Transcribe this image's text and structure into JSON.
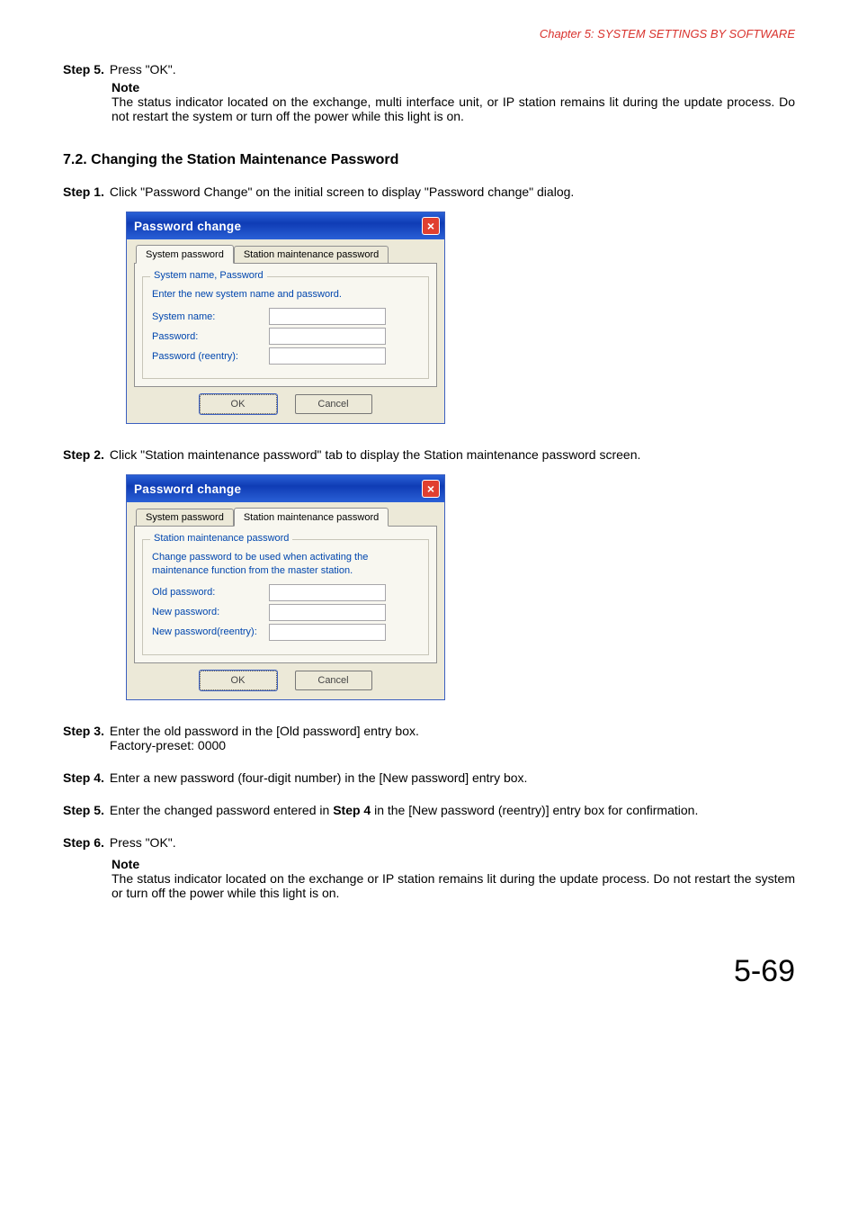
{
  "chapter_header": "Chapter 5:  SYSTEM SETTINGS BY SOFTWARE",
  "top_step": {
    "label": "Step 5.",
    "text": "Press \"OK\".",
    "note_title": "Note",
    "note_text": "The status indicator located on the exchange, multi interface unit, or IP station remains lit during the update process. Do not restart the system or turn off the power while this light is on."
  },
  "section_heading": "7.2. Changing the Station Maintenance Password",
  "step1": {
    "label": "Step 1.",
    "text": "Click \"Password Change\" on the initial screen to display \"Password change\" dialog."
  },
  "dialog1": {
    "title": "Password change",
    "tab1": "System password",
    "tab2": "Station maintenance password",
    "group_title": "System name, Password",
    "group_desc": "Enter the new system name and password.",
    "row1": "System name:",
    "row2": "Password:",
    "row3": "Password (reentry):",
    "ok": "OK",
    "cancel": "Cancel"
  },
  "step2": {
    "label": "Step 2.",
    "text": "Click \"Station maintenance password\" tab to display the Station maintenance password screen."
  },
  "dialog2": {
    "title": "Password change",
    "tab1": "System password",
    "tab2": "Station maintenance password",
    "group_title": "Station maintenance password",
    "group_desc": "Change password to be used when activating the maintenance function from the master station.",
    "row1": "Old password:",
    "row2": "New password:",
    "row3": "New password(reentry):",
    "ok": "OK",
    "cancel": "Cancel"
  },
  "step3": {
    "label": "Step 3.",
    "text_line1": "Enter the old password in the [Old password] entry box.",
    "text_line2": "Factory-preset: 0000"
  },
  "step4": {
    "label": "Step 4.",
    "text": "Enter a new password (four-digit number) in the [New password] entry box."
  },
  "step5": {
    "label": "Step 5.",
    "prefix": "Enter the changed password entered in ",
    "bold": "Step 4",
    "suffix": " in the [New password (reentry)] entry box for confirmation."
  },
  "step6": {
    "label": "Step 6.",
    "text": "Press \"OK\".",
    "note_title": "Note",
    "note_text": "The status indicator located on the exchange or IP station remains lit during the update process. Do not restart the system or turn off the power while this light is on."
  },
  "page_number": "5-69"
}
